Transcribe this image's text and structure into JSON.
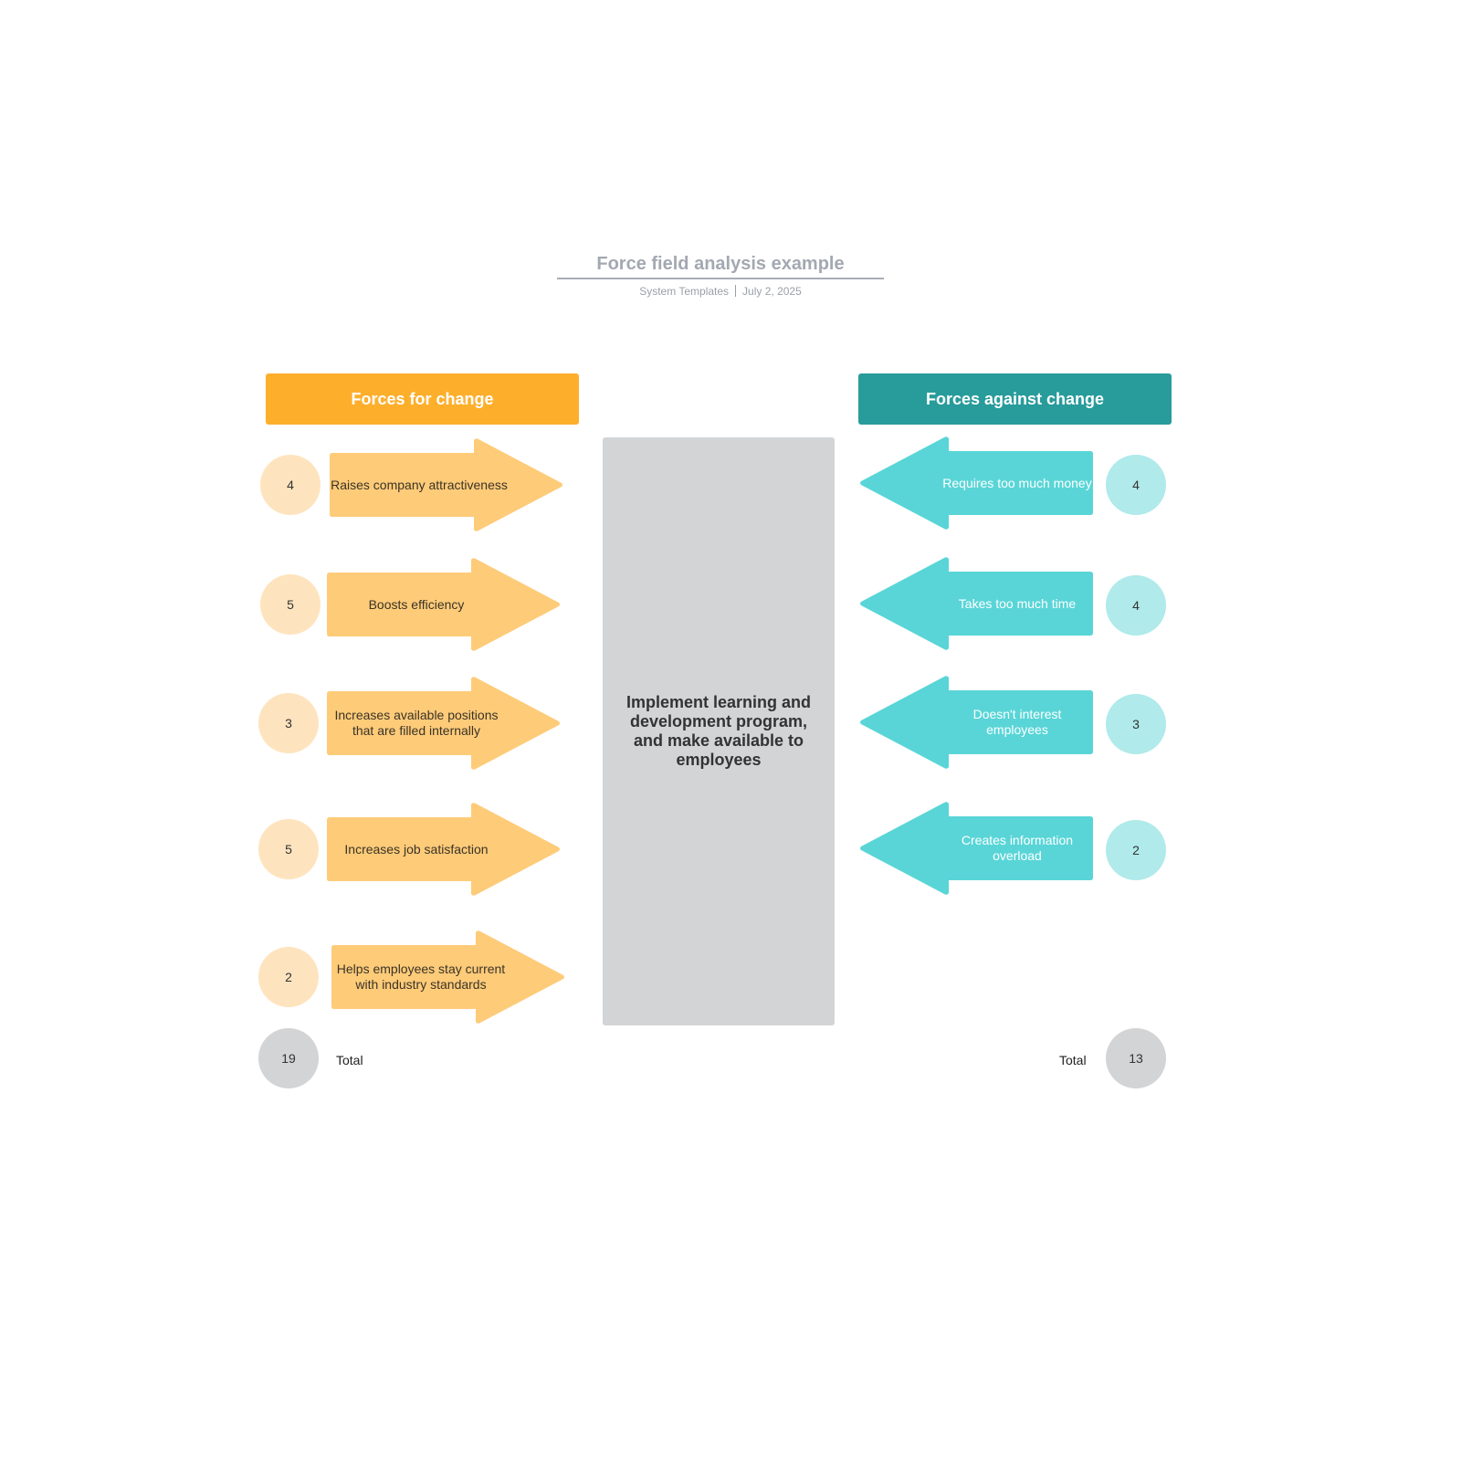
{
  "document": {
    "title": "Force field analysis example",
    "author": "System Templates",
    "date": "July 2, 2025"
  },
  "colors": {
    "for_header": "#fdaf2c",
    "for_arrow": "#fecb79",
    "for_circle": "#fee4be",
    "against_header": "#289b9b",
    "against_arrow": "#59d5d7",
    "against_circle": "#b0eaea",
    "center": "#d3d4d6"
  },
  "for_change": {
    "header": "Forces for change",
    "forces": [
      {
        "label": "Raises company attractiveness",
        "score": "4"
      },
      {
        "label": "Boosts efficiency",
        "score": "5"
      },
      {
        "label": "Increases available positions that are filled internally",
        "score": "3"
      },
      {
        "label": "Increases job satisfaction",
        "score": "5"
      },
      {
        "label": "Helps employees stay current with industry standards",
        "score": "2"
      }
    ],
    "total_label": "Total",
    "total": "19"
  },
  "against_change": {
    "header": "Forces against change",
    "forces": [
      {
        "label": "Requires too much money",
        "score": "4"
      },
      {
        "label": "Takes too much time",
        "score": "4"
      },
      {
        "label": "Doesn't interest employees",
        "score": "3"
      },
      {
        "label": "Creates information overload",
        "score": "2"
      }
    ],
    "total_label": "Total",
    "total": "13"
  },
  "proposed_change": "Implement learning and development program, and make available to employees"
}
